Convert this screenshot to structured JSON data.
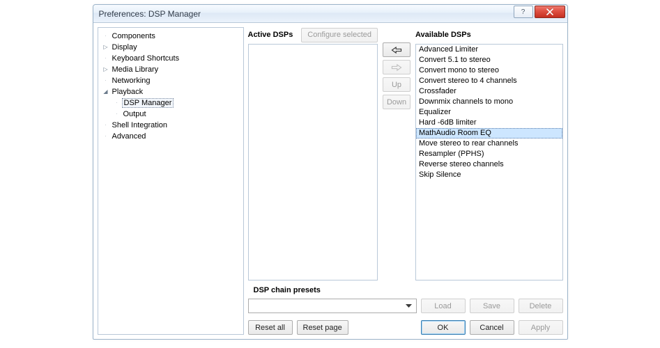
{
  "window": {
    "title": "Preferences: DSP Manager"
  },
  "tree": {
    "items": [
      {
        "label": "Components",
        "exp": "closed"
      },
      {
        "label": "Display",
        "exp": "expandable"
      },
      {
        "label": "Keyboard Shortcuts",
        "exp": "closed"
      },
      {
        "label": "Media Library",
        "exp": "expandable"
      },
      {
        "label": "Networking",
        "exp": "closed"
      },
      {
        "label": "Playback",
        "exp": "expanded",
        "children": [
          {
            "label": "DSP Manager",
            "selected": true
          },
          {
            "label": "Output"
          }
        ]
      },
      {
        "label": "Shell Integration",
        "exp": "closed"
      },
      {
        "label": "Advanced",
        "exp": "closed"
      }
    ]
  },
  "active": {
    "title": "Active DSPs",
    "configure_label": "Configure selected",
    "items": []
  },
  "mid": {
    "up_label": "Up",
    "down_label": "Down"
  },
  "available": {
    "title": "Available DSPs",
    "items": [
      "Advanced Limiter",
      "Convert 5.1 to stereo",
      "Convert mono to stereo",
      "Convert stereo to 4 channels",
      "Crossfader",
      "Downmix channels to mono",
      "Equalizer",
      "Hard -6dB limiter",
      "MathAudio Room EQ",
      "Move stereo to rear channels",
      "Resampler (PPHS)",
      "Reverse stereo channels",
      "Skip Silence"
    ],
    "selected_index": 8
  },
  "presets": {
    "title": "DSP chain presets",
    "value": "",
    "load_label": "Load",
    "save_label": "Save",
    "delete_label": "Delete"
  },
  "footer": {
    "reset_all_label": "Reset all",
    "reset_page_label": "Reset page",
    "ok_label": "OK",
    "cancel_label": "Cancel",
    "apply_label": "Apply"
  }
}
